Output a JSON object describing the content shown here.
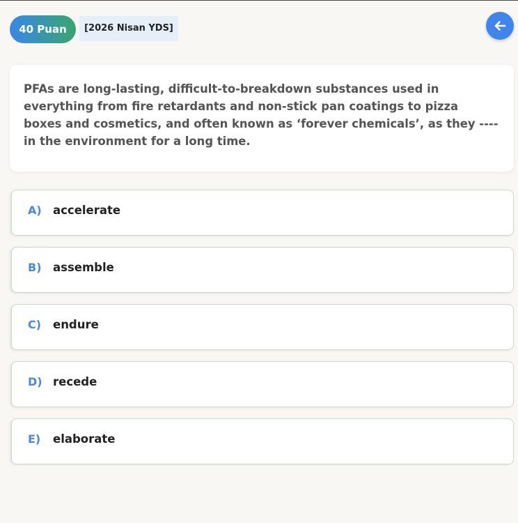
{
  "header": {
    "points_badge": "40 Puan",
    "exam_tag": "[2026 Nisan YDS]",
    "back_icon": "arrow-left-icon"
  },
  "question": {
    "text": "PFAs are long-lasting, difficult-to-breakdown substances used in everything from fire retardants and non-stick pan coatings to pizza boxes and cosmetics, and often known as ‘forever chemicals’, as they ---- in the environment for a long time."
  },
  "options": [
    {
      "letter": "A)",
      "text": "accelerate"
    },
    {
      "letter": "B)",
      "text": "assemble"
    },
    {
      "letter": "C)",
      "text": "endure"
    },
    {
      "letter": "D)",
      "text": "recede"
    },
    {
      "letter": "E)",
      "text": "elaborate"
    }
  ],
  "colors": {
    "badge_gradient_start": "#3a86e8",
    "badge_gradient_end": "#3aa56e",
    "accent_blue": "#4a88e6",
    "page_background": "#f8f7f3"
  }
}
